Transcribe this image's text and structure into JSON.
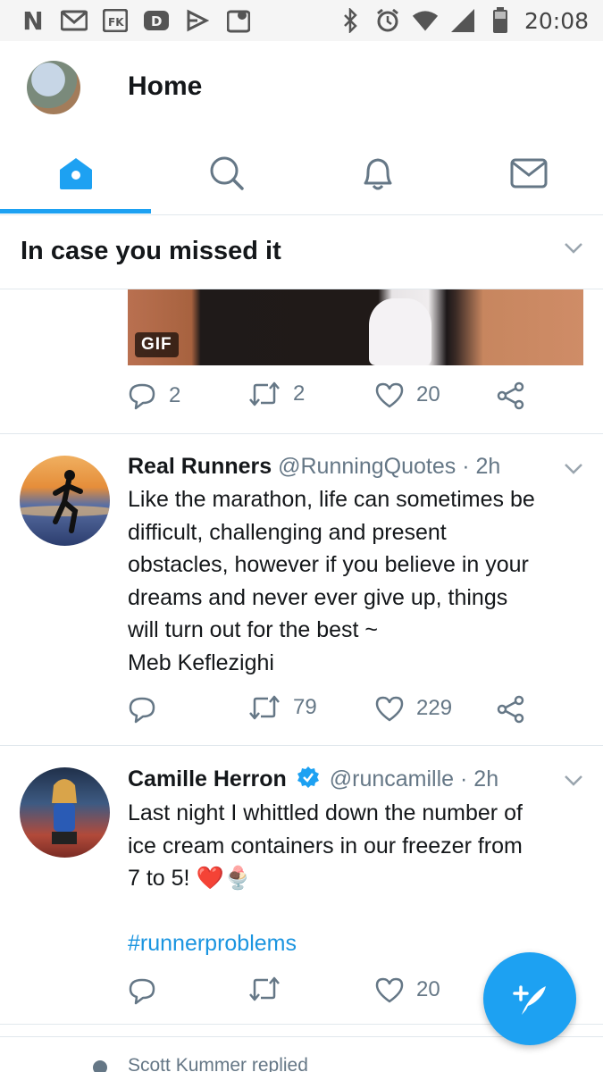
{
  "status_bar": {
    "time": "20:08",
    "left_icons": [
      "netflix-icon",
      "gmail-icon",
      "fk-icon",
      "d-app-icon",
      "airtel-icon",
      "maps-icon"
    ],
    "right_icons": [
      "bluetooth-icon",
      "alarm-icon",
      "wifi-icon",
      "signal-icon",
      "battery-icon"
    ],
    "n_letter": "N"
  },
  "header": {
    "title": "Home"
  },
  "tabs": [
    {
      "name": "home",
      "icon": "home-icon",
      "active": true
    },
    {
      "name": "search",
      "icon": "search-icon",
      "active": false
    },
    {
      "name": "notifications",
      "icon": "bell-icon",
      "active": false
    },
    {
      "name": "messages",
      "icon": "mail-icon",
      "active": false
    }
  ],
  "section": {
    "title": "In case you missed it"
  },
  "gif_tweet": {
    "badge": "GIF",
    "replies": "2",
    "retweets": "2",
    "likes": "20"
  },
  "tweets": [
    {
      "name": "Real Runners",
      "handle": "@RunningQuotes",
      "time": "· 2h",
      "verified": false,
      "lines": [
        "Like the marathon, life can sometimes be",
        "difficult, challenging and present",
        "obstacles, however if you believe in your",
        "dreams and never ever give up, things",
        "will turn out for the best ~",
        "Meb Keflezighi"
      ],
      "replies": "",
      "retweets": "79",
      "likes": "229"
    },
    {
      "name": "Camille Herron",
      "handle": "@runcamille",
      "time": "· 2h",
      "verified": true,
      "lines": [
        "Last night I whittled down the number of",
        "ice cream containers in our freezer from",
        "7 to 5! ❤️🍨"
      ],
      "hashtag": "#runnerproblems",
      "replies": "",
      "retweets": "",
      "likes": "20"
    }
  ],
  "bottom": {
    "replied_text": "Scott Kummer replied"
  },
  "colors": {
    "accent": "#1da1f2",
    "secondary_text": "#657786",
    "divider": "#e1e8ed"
  }
}
